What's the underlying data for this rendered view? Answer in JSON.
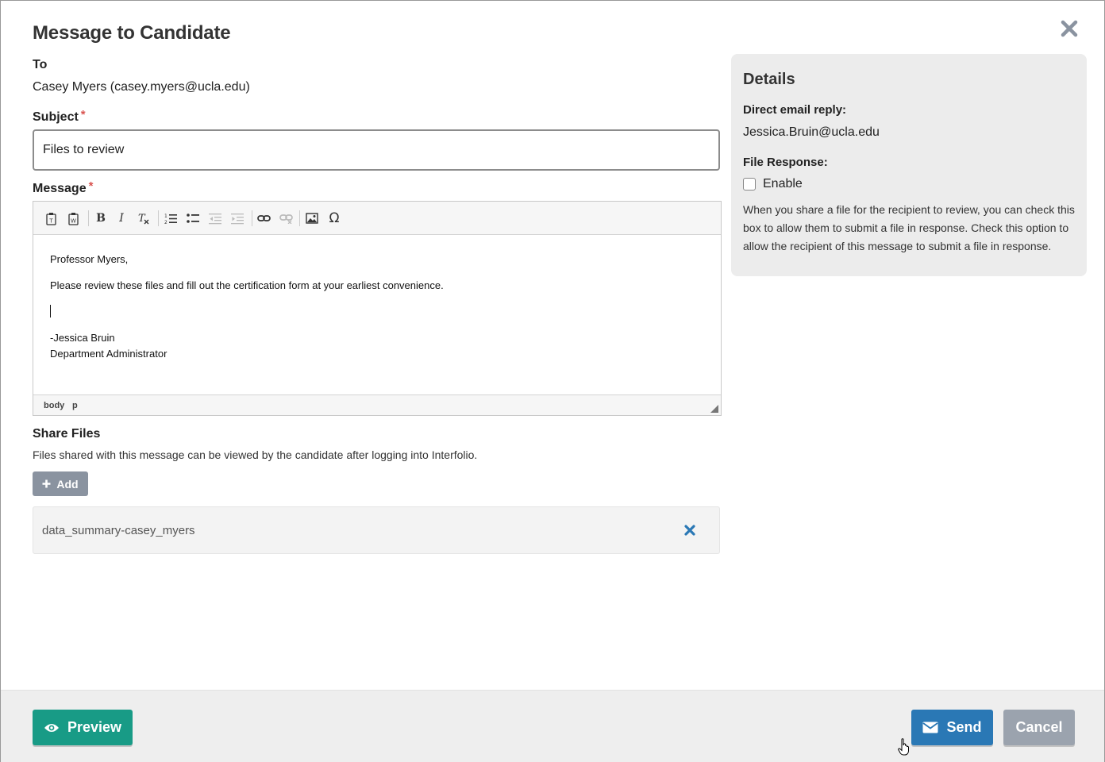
{
  "dialog": {
    "title": "Message to Candidate"
  },
  "to": {
    "label": "To",
    "value": "Casey Myers (casey.myers@ucla.edu)"
  },
  "subject": {
    "label": "Subject",
    "required_mark": "*",
    "value": "Files to review"
  },
  "message": {
    "label": "Message",
    "required_mark": "*",
    "toolbar": [
      "paste-text-icon",
      "paste-word-icon",
      "bold-icon",
      "italic-icon",
      "remove-format-icon",
      "numbered-list-icon",
      "bulleted-list-icon",
      "outdent-icon",
      "indent-icon",
      "link-icon",
      "unlink-icon",
      "image-icon",
      "special-char-icon"
    ],
    "bold_glyph": "B",
    "italic_glyph": "I",
    "omega_glyph": "Ω",
    "body": {
      "greeting": "Professor Myers,",
      "line1": "Please review these files and fill out the certification form at your earliest convenience.",
      "signature_name": "-Jessica Bruin",
      "signature_title": "Department Administrator"
    },
    "status_path": [
      "body",
      "p"
    ]
  },
  "share_files": {
    "label": "Share Files",
    "description": "Files shared with this message can be viewed by the candidate after logging into Interfolio.",
    "add_label": "Add",
    "files": [
      {
        "name": "data_summary-casey_myers"
      }
    ]
  },
  "details": {
    "heading": "Details",
    "reply_label": "Direct email reply:",
    "reply_value": "Jessica.Bruin@ucla.edu",
    "file_response_label": "File Response:",
    "enable_label": "Enable",
    "enable_checked": false,
    "help_text": "When you share a file for the recipient to review, you can check this box to allow them to submit a file in response. Check this option to allow the recipient of this message to submit a file in response."
  },
  "footer": {
    "preview_label": "Preview",
    "send_label": "Send",
    "cancel_label": "Cancel"
  },
  "colors": {
    "preview": "#189b86",
    "send": "#2a78b5",
    "cancel": "#9ba3ae",
    "required": "#d9534f",
    "remove_icon": "#2a78b5"
  }
}
